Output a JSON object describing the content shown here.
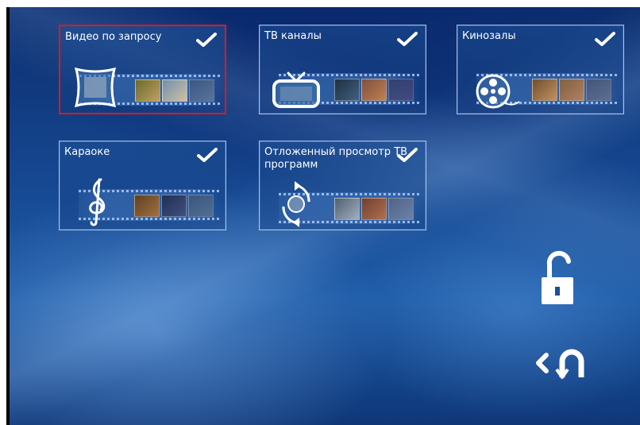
{
  "tiles": [
    {
      "label": "Видео по запросу",
      "icon": "film-icon",
      "selected": true
    },
    {
      "label": "ТВ каналы",
      "icon": "tv-icon",
      "selected": false
    },
    {
      "label": "Кинозалы",
      "icon": "film-reel-icon",
      "selected": false
    },
    {
      "label": "Караоке",
      "icon": "treble-clef-icon",
      "selected": false
    },
    {
      "label": "Отложенный просмотр ТВ программ",
      "icon": "timeshift-icon",
      "selected": false
    }
  ],
  "side_actions": [
    {
      "name": "unlock",
      "icon": "unlock-icon"
    },
    {
      "name": "back",
      "icon": "back-icon"
    }
  ],
  "colors": {
    "selection_border": "#e01818",
    "background": "#174a94",
    "tile_border": "#c8e1ff"
  }
}
